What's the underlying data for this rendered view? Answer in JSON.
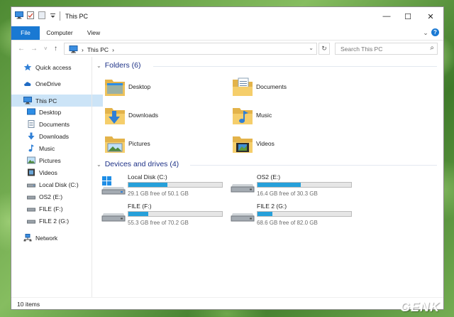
{
  "window": {
    "title": "This PC",
    "controls": {
      "minimize": "—",
      "maximize": "☐",
      "close": "✕"
    }
  },
  "ribbon": {
    "tabs": [
      "File",
      "Computer",
      "View"
    ],
    "expand_icon": "chevron-down-icon",
    "help": "?"
  },
  "navigation": {
    "back": "←",
    "forward": "→",
    "recent": "˅",
    "up": "↑",
    "address": {
      "sep": "›",
      "location": "This PC",
      "trailing_sep": "›"
    },
    "refresh": "↻",
    "search_placeholder": "Search This PC",
    "search_icon": "⌕"
  },
  "sidebar": {
    "items": [
      {
        "label": "Quick access",
        "icon": "star-icon"
      },
      {
        "label": "OneDrive",
        "icon": "cloud-icon"
      },
      {
        "label": "This PC",
        "icon": "computer-icon",
        "selected": true
      },
      {
        "label": "Desktop",
        "icon": "desktop-icon"
      },
      {
        "label": "Documents",
        "icon": "documents-icon"
      },
      {
        "label": "Downloads",
        "icon": "downloads-icon"
      },
      {
        "label": "Music",
        "icon": "music-icon"
      },
      {
        "label": "Pictures",
        "icon": "pictures-icon"
      },
      {
        "label": "Videos",
        "icon": "videos-icon"
      },
      {
        "label": "Local Disk (C:)",
        "icon": "drive-icon"
      },
      {
        "label": "OS2 (E:)",
        "icon": "drive-icon"
      },
      {
        "label": "FILE (F:)",
        "icon": "drive-icon"
      },
      {
        "label": "FILE 2 (G:)",
        "icon": "drive-icon"
      },
      {
        "label": "Network",
        "icon": "network-icon"
      }
    ]
  },
  "folders": {
    "header": "Folders (6)",
    "items": [
      "Desktop",
      "Documents",
      "Downloads",
      "Music",
      "Pictures",
      "Videos"
    ]
  },
  "drives": {
    "header": "Devices and drives (4)",
    "items": [
      {
        "name": "Local Disk (C:)",
        "free": "29.1 GB free of 50.1 GB",
        "used_fraction": 0.42
      },
      {
        "name": "OS2 (E:)",
        "free": "16.4 GB free of 30.3 GB",
        "used_fraction": 0.46
      },
      {
        "name": "FILE (F:)",
        "free": "55.3 GB free of 70.2 GB",
        "used_fraction": 0.21
      },
      {
        "name": "FILE 2 (G:)",
        "free": "68.6 GB free of 82.0 GB",
        "used_fraction": 0.16
      }
    ]
  },
  "status": {
    "items": "10 items"
  },
  "watermark": "GENK",
  "colors": {
    "accent": "#1a79d3",
    "bar_fill": "#26a0da",
    "group_header": "#1e3287",
    "selection": "#cce4f7"
  }
}
